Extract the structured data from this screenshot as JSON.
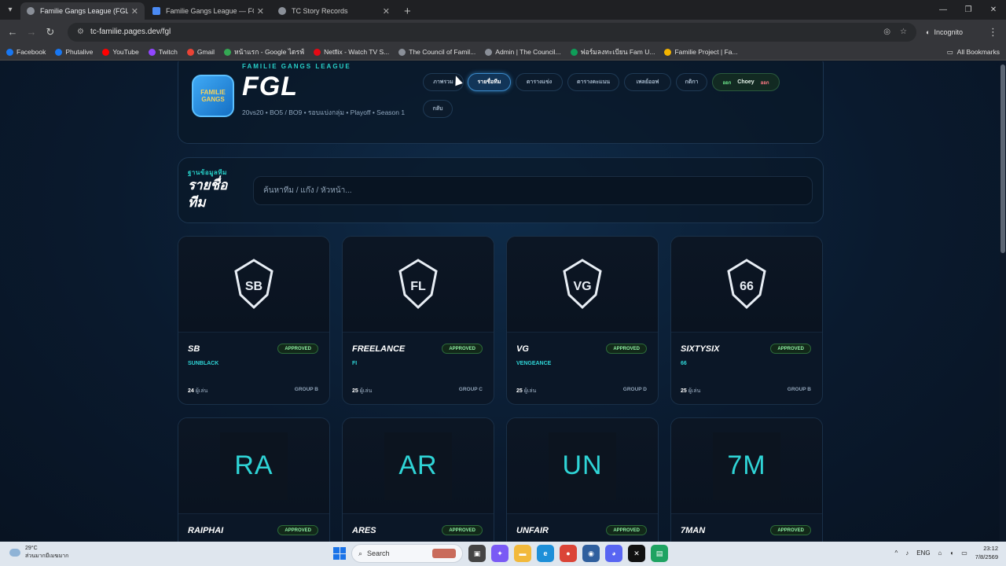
{
  "browser": {
    "tabs": [
      {
        "title": "Familie Gangs League (FGL)",
        "active": true,
        "favicon_color": "#8a8f98"
      },
      {
        "title": "Familie Gangs League — FGL S...",
        "active": false,
        "favicon_color": "#4a8af4"
      },
      {
        "title": "TC Story Records",
        "active": false,
        "favicon_color": "#8a8f98"
      }
    ],
    "url": "tc-familie.pages.dev/fgl",
    "incognito_label": "Incognito",
    "bookmarks": [
      {
        "label": "Facebook",
        "color": "#1877f2"
      },
      {
        "label": "Phutalive",
        "color": "#1877f2"
      },
      {
        "label": "YouTube",
        "color": "#ff0000"
      },
      {
        "label": "Twitch",
        "color": "#9146ff"
      },
      {
        "label": "Gmail",
        "color": "#ea4335"
      },
      {
        "label": "หน้าแรก - Google ไดรฟ์",
        "color": "#34a853"
      },
      {
        "label": "Netflix - Watch TV S...",
        "color": "#e50914"
      },
      {
        "label": "The Council of Famil...",
        "color": "#8a8f98"
      },
      {
        "label": "Admin | The Council...",
        "color": "#8a8f98"
      },
      {
        "label": "ฟอร์มลงทะเบียน Fam U...",
        "color": "#0f9d58"
      },
      {
        "label": "Familie Project | Fa...",
        "color": "#f4b400"
      }
    ],
    "all_bookmarks": "All Bookmarks"
  },
  "header": {
    "league_name": "FAMILIE GANGS LEAGUE",
    "league_abbr": "FGL",
    "description": "20vs20 • BO5 / BO9 • รอบแบ่งกลุ่ม • Playoff • Season 1",
    "logo_text": "FAMILIE GANGS",
    "nav": [
      {
        "label": "ภาพรวม",
        "active": false
      },
      {
        "label": "รายชื่อทีม",
        "active": true
      },
      {
        "label": "ตารางแข่ง",
        "active": false
      },
      {
        "label": "ตารางคะแนน",
        "active": false
      },
      {
        "label": "เพลย์ออฟ",
        "active": false
      },
      {
        "label": "กติกา",
        "active": false
      },
      {
        "label": "กลับ",
        "active": false
      }
    ],
    "user": {
      "prefix": "ออก",
      "name": "Choey",
      "suffix": "ออก"
    }
  },
  "search_section": {
    "kicker": "ฐานข้อมูลทีม",
    "title": "รายชื่อทีม",
    "placeholder": "ค้นหาทีม / แก๊ง / หัวหน้า..."
  },
  "teams": [
    {
      "tag": "SB",
      "full_name": "SUNBLACK",
      "status": "APPROVED",
      "players": "24",
      "players_unit": "ผู้เล่น",
      "group": "GROUP B",
      "logo": "SB"
    },
    {
      "tag": "FREELANCE",
      "full_name": "FI",
      "status": "APPROVED",
      "players": "25",
      "players_unit": "ผู้เล่น",
      "group": "GROUP C",
      "logo": "FL"
    },
    {
      "tag": "VG",
      "full_name": "VENGEANCE",
      "status": "APPROVED",
      "players": "25",
      "players_unit": "ผู้เล่น",
      "group": "GROUP D",
      "logo": "VG"
    },
    {
      "tag": "SIXTYSIX",
      "full_name": "66",
      "status": "APPROVED",
      "players": "25",
      "players_unit": "ผู้เล่น",
      "group": "GROUP B",
      "logo": "66"
    },
    {
      "tag": "RAIPHAI",
      "full_name": "",
      "status": "APPROVED",
      "players": "",
      "players_unit": "",
      "group": "",
      "logo": "RA"
    },
    {
      "tag": "ARES",
      "full_name": "",
      "status": "APPROVED",
      "players": "",
      "players_unit": "",
      "group": "",
      "logo": "AR"
    },
    {
      "tag": "UNFAIR",
      "full_name": "",
      "status": "APPROVED",
      "players": "",
      "players_unit": "",
      "group": "",
      "logo": "UN"
    },
    {
      "tag": "7MAN",
      "full_name": "",
      "status": "APPROVED",
      "players": "",
      "players_unit": "",
      "group": "",
      "logo": "7M"
    }
  ],
  "taskbar": {
    "weather_temp": "29°C",
    "weather_desc": "ส่วนมากมีเมฆมาก",
    "search_label": "Search",
    "lang": "ENG",
    "time": "23:12",
    "date": "7/8/2569"
  }
}
